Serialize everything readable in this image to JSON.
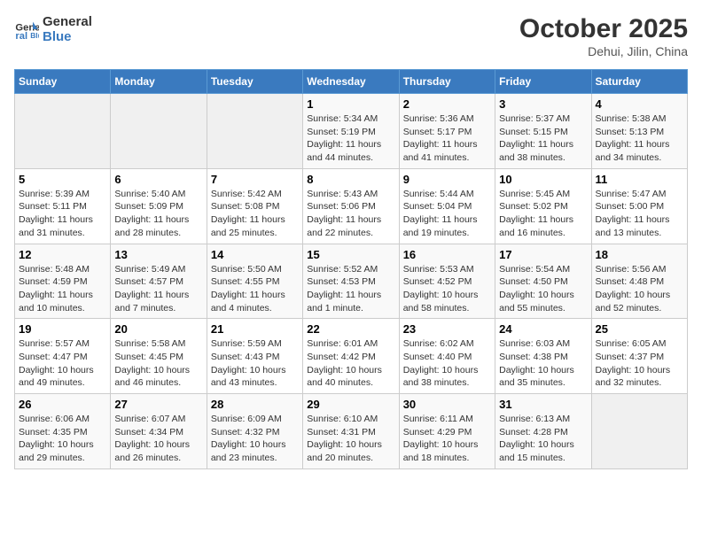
{
  "header": {
    "logo_line1": "General",
    "logo_line2": "Blue",
    "month": "October 2025",
    "location": "Dehui, Jilin, China"
  },
  "weekdays": [
    "Sunday",
    "Monday",
    "Tuesday",
    "Wednesday",
    "Thursday",
    "Friday",
    "Saturday"
  ],
  "weeks": [
    [
      {
        "day": "",
        "empty": true
      },
      {
        "day": "",
        "empty": true
      },
      {
        "day": "",
        "empty": true
      },
      {
        "day": "1",
        "sunrise": "5:34 AM",
        "sunset": "5:19 PM",
        "daylight": "11 hours and 44 minutes."
      },
      {
        "day": "2",
        "sunrise": "5:36 AM",
        "sunset": "5:17 PM",
        "daylight": "11 hours and 41 minutes."
      },
      {
        "day": "3",
        "sunrise": "5:37 AM",
        "sunset": "5:15 PM",
        "daylight": "11 hours and 38 minutes."
      },
      {
        "day": "4",
        "sunrise": "5:38 AM",
        "sunset": "5:13 PM",
        "daylight": "11 hours and 34 minutes."
      }
    ],
    [
      {
        "day": "5",
        "sunrise": "5:39 AM",
        "sunset": "5:11 PM",
        "daylight": "11 hours and 31 minutes."
      },
      {
        "day": "6",
        "sunrise": "5:40 AM",
        "sunset": "5:09 PM",
        "daylight": "11 hours and 28 minutes."
      },
      {
        "day": "7",
        "sunrise": "5:42 AM",
        "sunset": "5:08 PM",
        "daylight": "11 hours and 25 minutes."
      },
      {
        "day": "8",
        "sunrise": "5:43 AM",
        "sunset": "5:06 PM",
        "daylight": "11 hours and 22 minutes."
      },
      {
        "day": "9",
        "sunrise": "5:44 AM",
        "sunset": "5:04 PM",
        "daylight": "11 hours and 19 minutes."
      },
      {
        "day": "10",
        "sunrise": "5:45 AM",
        "sunset": "5:02 PM",
        "daylight": "11 hours and 16 minutes."
      },
      {
        "day": "11",
        "sunrise": "5:47 AM",
        "sunset": "5:00 PM",
        "daylight": "11 hours and 13 minutes."
      }
    ],
    [
      {
        "day": "12",
        "sunrise": "5:48 AM",
        "sunset": "4:59 PM",
        "daylight": "11 hours and 10 minutes."
      },
      {
        "day": "13",
        "sunrise": "5:49 AM",
        "sunset": "4:57 PM",
        "daylight": "11 hours and 7 minutes."
      },
      {
        "day": "14",
        "sunrise": "5:50 AM",
        "sunset": "4:55 PM",
        "daylight": "11 hours and 4 minutes."
      },
      {
        "day": "15",
        "sunrise": "5:52 AM",
        "sunset": "4:53 PM",
        "daylight": "11 hours and 1 minute."
      },
      {
        "day": "16",
        "sunrise": "5:53 AM",
        "sunset": "4:52 PM",
        "daylight": "10 hours and 58 minutes."
      },
      {
        "day": "17",
        "sunrise": "5:54 AM",
        "sunset": "4:50 PM",
        "daylight": "10 hours and 55 minutes."
      },
      {
        "day": "18",
        "sunrise": "5:56 AM",
        "sunset": "4:48 PM",
        "daylight": "10 hours and 52 minutes."
      }
    ],
    [
      {
        "day": "19",
        "sunrise": "5:57 AM",
        "sunset": "4:47 PM",
        "daylight": "10 hours and 49 minutes."
      },
      {
        "day": "20",
        "sunrise": "5:58 AM",
        "sunset": "4:45 PM",
        "daylight": "10 hours and 46 minutes."
      },
      {
        "day": "21",
        "sunrise": "5:59 AM",
        "sunset": "4:43 PM",
        "daylight": "10 hours and 43 minutes."
      },
      {
        "day": "22",
        "sunrise": "6:01 AM",
        "sunset": "4:42 PM",
        "daylight": "10 hours and 40 minutes."
      },
      {
        "day": "23",
        "sunrise": "6:02 AM",
        "sunset": "4:40 PM",
        "daylight": "10 hours and 38 minutes."
      },
      {
        "day": "24",
        "sunrise": "6:03 AM",
        "sunset": "4:38 PM",
        "daylight": "10 hours and 35 minutes."
      },
      {
        "day": "25",
        "sunrise": "6:05 AM",
        "sunset": "4:37 PM",
        "daylight": "10 hours and 32 minutes."
      }
    ],
    [
      {
        "day": "26",
        "sunrise": "6:06 AM",
        "sunset": "4:35 PM",
        "daylight": "10 hours and 29 minutes."
      },
      {
        "day": "27",
        "sunrise": "6:07 AM",
        "sunset": "4:34 PM",
        "daylight": "10 hours and 26 minutes."
      },
      {
        "day": "28",
        "sunrise": "6:09 AM",
        "sunset": "4:32 PM",
        "daylight": "10 hours and 23 minutes."
      },
      {
        "day": "29",
        "sunrise": "6:10 AM",
        "sunset": "4:31 PM",
        "daylight": "10 hours and 20 minutes."
      },
      {
        "day": "30",
        "sunrise": "6:11 AM",
        "sunset": "4:29 PM",
        "daylight": "10 hours and 18 minutes."
      },
      {
        "day": "31",
        "sunrise": "6:13 AM",
        "sunset": "4:28 PM",
        "daylight": "10 hours and 15 minutes."
      },
      {
        "day": "",
        "empty": true
      }
    ]
  ]
}
